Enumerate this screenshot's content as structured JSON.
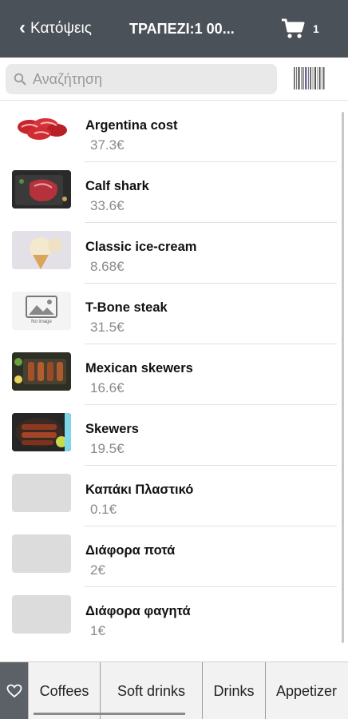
{
  "header": {
    "back_label": "Κατόψεις",
    "title": "ΤΡΑΠΕΖΙ:1 00...",
    "cart_count": "1",
    "back_icon": "chevron-left-icon",
    "cart_icon": "cart-icon"
  },
  "search": {
    "placeholder": "Αναζήτηση",
    "value": "",
    "icon": "search-icon",
    "barcode_icon": "barcode-icon"
  },
  "products": [
    {
      "name": "Argentina cost",
      "price": "37.3€",
      "image": "raw-meat"
    },
    {
      "name": "Calf shark",
      "price": "33.6€",
      "image": "steak-board"
    },
    {
      "name": "Classic ice-cream",
      "price": "8.68€",
      "image": "ice-cream"
    },
    {
      "name": "T-Bone steak",
      "price": "31.5€",
      "image": "no-image"
    },
    {
      "name": "Mexican skewers",
      "price": "16.6€",
      "image": "skewers-platter"
    },
    {
      "name": "Skewers",
      "price": "19.5€",
      "image": "skewers-plate"
    },
    {
      "name": "Καπάκι Πλαστικό",
      "price": "0.1€",
      "image": "placeholder"
    },
    {
      "name": "Διάφορα ποτά",
      "price": "2€",
      "image": "placeholder"
    },
    {
      "name": "Διάφορα φαγητά",
      "price": "1€",
      "image": "placeholder"
    }
  ],
  "no_image_label": "No image",
  "categories": {
    "favorites_icon": "heart-icon",
    "tabs": [
      "Coffees",
      "Soft drinks",
      "Drinks",
      "Appetizer"
    ]
  },
  "colors": {
    "header_bg": "#4b5158",
    "price_text": "#8a8a8a",
    "search_bg": "#e9e9e9"
  }
}
